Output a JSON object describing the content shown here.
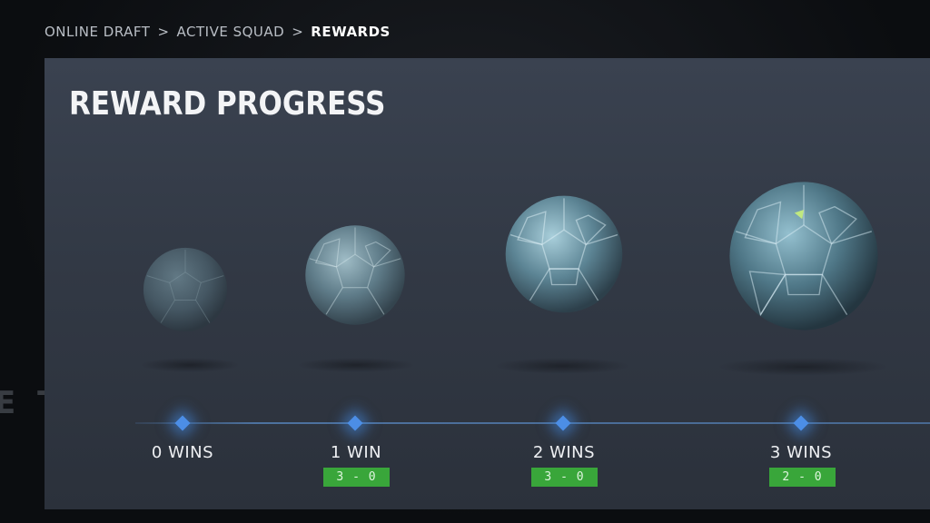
{
  "breadcrumb": {
    "items": [
      "ONLINE DRAFT",
      "ACTIVE SQUAD"
    ],
    "current": "REWARDS",
    "separator": ">"
  },
  "background": {
    "ghost_text": "E TI"
  },
  "panel": {
    "title": "REWARD PROGRESS"
  },
  "tiers": [
    {
      "label": "0 WINS",
      "record": ""
    },
    {
      "label": "1 WIN",
      "record": "3 - 0"
    },
    {
      "label": "2 WINS",
      "record": "3 - 0"
    },
    {
      "label": "3 WINS",
      "record": "2 - 0"
    }
  ],
  "colors": {
    "panel": "#343b47",
    "badge": "#39a63a",
    "node": "#4c8ee6"
  }
}
